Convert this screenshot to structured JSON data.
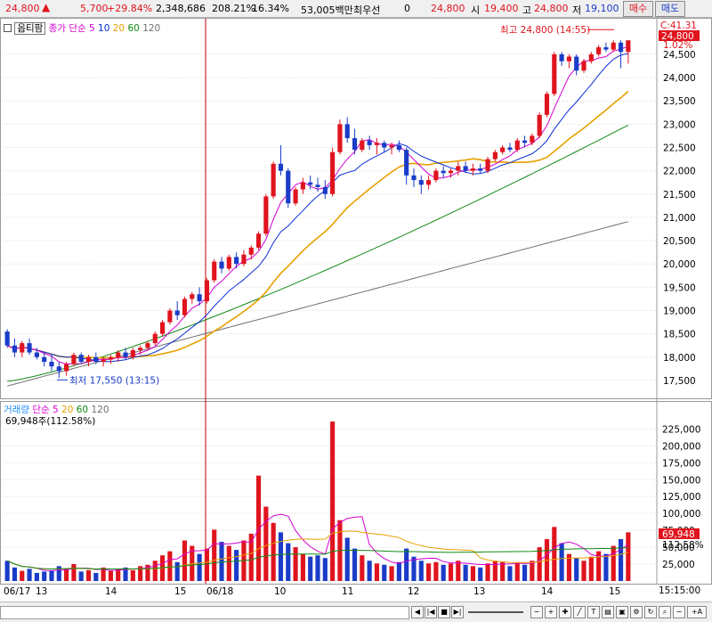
{
  "header": {
    "price": "24,800",
    "up_arrow": "up-arrow",
    "change": "5,700",
    "change_pct": "+29.84%",
    "volume": "2,348,686",
    "vol_ratio": "208.21%",
    "turnover_pct": "16.34%",
    "trade_value": "53,005백만",
    "priority_label": "최우선",
    "priority_value": "0",
    "ask_price": "24,800",
    "open_label": "시",
    "open": "19,400",
    "high_label": "고",
    "high": "24,800",
    "low_label": "저",
    "low": "19,100",
    "buy_button": "매수",
    "sell_button": "매도"
  },
  "price_panel": {
    "options_label": "옵티팜",
    "indicator_name": "종가 단순",
    "ma_periods": [
      "5",
      "10",
      "20",
      "60",
      "120"
    ],
    "ma_colors": [
      "#d400d4",
      "#0b2fd6",
      "#e6a000",
      "#138a13",
      "#707070"
    ],
    "current_price_tag": "24,800",
    "corner_label": "C:41.31",
    "change_tag": "1.02%",
    "high_annotation": "최고 24,800 (14:55)",
    "low_annotation": "최저 17,550 (13:15)",
    "y_ticks": [
      "24,500",
      "24,000",
      "23,500",
      "23,000",
      "22,500",
      "22,000",
      "21,500",
      "21,000",
      "20,500",
      "20,000",
      "19,500",
      "19,000",
      "18,500",
      "18,000",
      "17,500"
    ]
  },
  "volume_panel": {
    "indicator_name": "거래량",
    "ma_label": "단순",
    "ma_periods": [
      "5",
      "20",
      "60",
      "120"
    ],
    "summary": "69,948주(112.58%)",
    "current_tag": "69,948",
    "pct_tag": "112.58%",
    "y_ticks": [
      "225,000",
      "200,000",
      "175,000",
      "150,000",
      "125,000",
      "100,000",
      "75,000",
      "50,000",
      "25,000"
    ]
  },
  "x_axis": {
    "labels": [
      "06/17",
      "13",
      "14",
      "15",
      "06/18",
      "10",
      "11",
      "12",
      "13",
      "14",
      "15"
    ],
    "time_label": "15:15:00"
  },
  "colors": {
    "up": "#e0141e",
    "down": "#1a3cc8",
    "grid": "#d9d9d9"
  },
  "chart_data": {
    "type": "candlestick",
    "y_range": [
      17250,
      24900
    ],
    "volume_range": [
      0,
      240000
    ],
    "candles": [
      [
        18550,
        18600,
        18200,
        18250
      ],
      [
        18250,
        18400,
        18000,
        18100
      ],
      [
        18100,
        18350,
        18000,
        18300
      ],
      [
        18300,
        18400,
        18050,
        18100
      ],
      [
        18100,
        18200,
        17950,
        18000
      ],
      [
        18000,
        18100,
        17800,
        17900
      ],
      [
        17900,
        18050,
        17700,
        17800
      ],
      [
        17800,
        17900,
        17550,
        17700
      ],
      [
        17700,
        17900,
        17600,
        17850
      ],
      [
        17850,
        18100,
        17800,
        18050
      ],
      [
        18050,
        18100,
        17850,
        17900
      ],
      [
        17900,
        18050,
        17800,
        18000
      ],
      [
        18000,
        18100,
        17850,
        17900
      ],
      [
        17900,
        18000,
        17800,
        17950
      ],
      [
        17950,
        18050,
        17850,
        18000
      ],
      [
        18000,
        18150,
        17900,
        18100
      ],
      [
        18100,
        18200,
        17950,
        18000
      ],
      [
        18000,
        18200,
        17950,
        18150
      ],
      [
        18150,
        18250,
        18050,
        18200
      ],
      [
        18200,
        18350,
        18150,
        18300
      ],
      [
        18300,
        18550,
        18250,
        18500
      ],
      [
        18500,
        18800,
        18450,
        18750
      ],
      [
        18750,
        19050,
        18700,
        19000
      ],
      [
        19000,
        19200,
        18800,
        18900
      ],
      [
        18900,
        19300,
        18850,
        19250
      ],
      [
        19250,
        19400,
        19150,
        19350
      ],
      [
        19350,
        19500,
        19100,
        19200
      ],
      [
        19200,
        19700,
        19150,
        19650
      ],
      [
        19650,
        20100,
        19600,
        20050
      ],
      [
        20050,
        20150,
        19800,
        19900
      ],
      [
        19900,
        20200,
        19850,
        20150
      ],
      [
        20150,
        20250,
        19900,
        20000
      ],
      [
        20000,
        20300,
        19950,
        20200
      ],
      [
        20200,
        20400,
        20100,
        20350
      ],
      [
        20350,
        20700,
        20300,
        20650
      ],
      [
        20650,
        21500,
        20600,
        21450
      ],
      [
        21450,
        22200,
        21400,
        22150
      ],
      [
        22150,
        22550,
        21900,
        22000
      ],
      [
        22000,
        22050,
        21200,
        21300
      ],
      [
        21300,
        21650,
        21250,
        21600
      ],
      [
        21600,
        21850,
        21500,
        21750
      ],
      [
        21750,
        21900,
        21600,
        21700
      ],
      [
        21700,
        21850,
        21550,
        21650
      ],
      [
        21650,
        21800,
        21400,
        21500
      ],
      [
        21500,
        22500,
        21450,
        22400
      ],
      [
        22400,
        23100,
        22350,
        23000
      ],
      [
        23000,
        23150,
        22600,
        22700
      ],
      [
        22700,
        22900,
        22350,
        22450
      ],
      [
        22450,
        22700,
        22400,
        22650
      ],
      [
        22650,
        22750,
        22450,
        22550
      ],
      [
        22550,
        22700,
        22350,
        22600
      ],
      [
        22600,
        22650,
        22400,
        22500
      ],
      [
        22500,
        22600,
        22350,
        22550
      ],
      [
        22550,
        22650,
        22400,
        22450
      ],
      [
        22450,
        22500,
        21700,
        21900
      ],
      [
        21900,
        22050,
        21650,
        21800
      ],
      [
        21800,
        21900,
        21500,
        21700
      ],
      [
        21700,
        21900,
        21600,
        21800
      ],
      [
        21800,
        22050,
        21750,
        22000
      ],
      [
        22000,
        22100,
        21850,
        21950
      ],
      [
        21950,
        22050,
        21850,
        22000
      ],
      [
        22000,
        22200,
        21900,
        22100
      ],
      [
        22100,
        22200,
        21950,
        22000
      ],
      [
        22000,
        22150,
        21900,
        22050
      ],
      [
        22050,
        22150,
        21950,
        22000
      ],
      [
        22000,
        22300,
        21950,
        22250
      ],
      [
        22250,
        22450,
        22200,
        22400
      ],
      [
        22400,
        22550,
        22350,
        22500
      ],
      [
        22500,
        22600,
        22400,
        22450
      ],
      [
        22450,
        22700,
        22400,
        22650
      ],
      [
        22650,
        22750,
        22500,
        22600
      ],
      [
        22600,
        22800,
        22550,
        22750
      ],
      [
        22750,
        23250,
        22700,
        23200
      ],
      [
        23200,
        23700,
        23150,
        23650
      ],
      [
        23650,
        24550,
        23600,
        24500
      ],
      [
        24500,
        24550,
        24250,
        24350
      ],
      [
        24350,
        24500,
        24200,
        24450
      ],
      [
        24450,
        24500,
        24050,
        24150
      ],
      [
        24150,
        24400,
        24100,
        24350
      ],
      [
        24350,
        24550,
        24300,
        24500
      ],
      [
        24500,
        24700,
        24450,
        24650
      ],
      [
        24650,
        24750,
        24550,
        24600
      ],
      [
        24600,
        24800,
        24550,
        24750
      ],
      [
        24750,
        24800,
        24200,
        24550
      ],
      [
        24550,
        24800,
        24300,
        24800
      ]
    ],
    "volumes": [
      30000,
      20000,
      15000,
      18000,
      12000,
      14000,
      16000,
      22000,
      18000,
      25000,
      14000,
      16000,
      12000,
      20000,
      15000,
      18000,
      20000,
      16000,
      22000,
      24000,
      30000,
      38000,
      44000,
      28000,
      60000,
      52000,
      40000,
      48000,
      76000,
      58000,
      52000,
      46000,
      60000,
      70000,
      156000,
      110000,
      86000,
      72000,
      56000,
      50000,
      40000,
      36000,
      38000,
      34000,
      236000,
      90000,
      64000,
      48000,
      38000,
      30000,
      26000,
      24000,
      22000,
      28000,
      48000,
      36000,
      30000,
      26000,
      28000,
      24000,
      26000,
      30000,
      24000,
      22000,
      20000,
      26000,
      30000,
      28000,
      22000,
      26000,
      24000,
      30000,
      50000,
      62000,
      80000,
      56000,
      40000,
      34000,
      30000,
      36000,
      44000,
      40000,
      52000,
      62000,
      72000
    ]
  }
}
